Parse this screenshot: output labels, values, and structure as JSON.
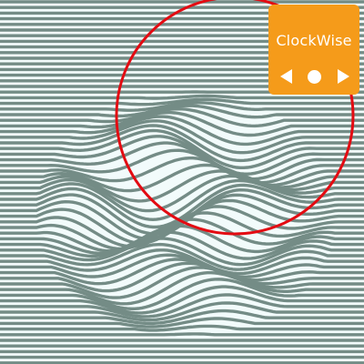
{
  "colors": {
    "background": "#f2fbfb",
    "stripe": "#748c86",
    "ring": "#e30b12",
    "panel": "#f59b1a",
    "panel_text": "#ffffff"
  },
  "controls": {
    "title": "ClockWise",
    "prev_icon": "left-triangle-icon",
    "play_icon": "circle-dot-icon",
    "next_icon": "right-triangle-icon"
  }
}
